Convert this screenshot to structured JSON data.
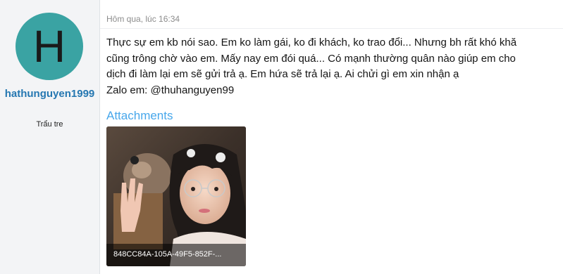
{
  "user": {
    "avatar_letter": "H",
    "avatar_color": "#3aa3a3",
    "username": "hathunguyen1999",
    "title": "Trẩu tre"
  },
  "post": {
    "timestamp": "Hôm qua, lúc 16:34",
    "message_lines": [
      "Thực sự em kb nói sao. Em ko làm gái, ko đi khách, ko trao đổi... Nhưng bh rất khó khă",
      "cũng trông chờ vào em. Mấy nay em đói quá... Có mạnh thường quân nào giúp em cho",
      "dịch đi làm lại em sẽ gửi trả ạ. Em hứa sẽ trả lại ạ. Ai chửi gì em xin nhận ạ",
      "Zalo em: @thuhanguyen99"
    ],
    "attachments_heading": "Attachments",
    "attachments": [
      {
        "filename": "848CC84A-105A-49F5-852F-..."
      }
    ]
  },
  "colors": {
    "username": "#2577b1",
    "attachments_heading": "#47a7eb",
    "sidebar_bg": "#f3f4f6"
  }
}
